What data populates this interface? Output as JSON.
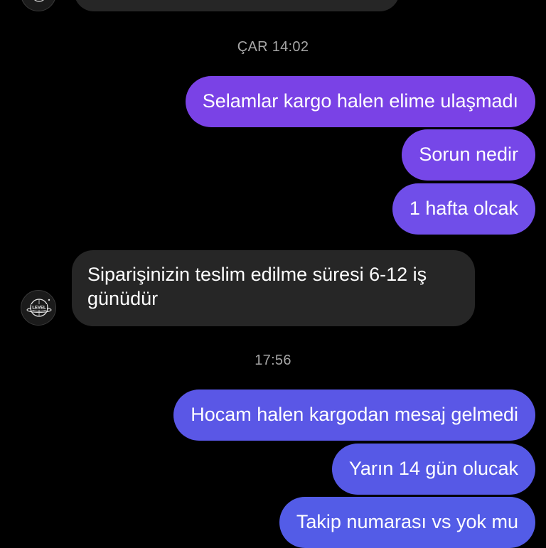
{
  "thread": {
    "timestamps": {
      "first": "ÇAR 14:02",
      "second": "17:56"
    },
    "avatar": {
      "icon": "brand-logo-icon",
      "text": "LEVEL"
    },
    "messages": [
      {
        "direction": "outgoing",
        "text": "Selamlar kargo halen elime ulaşmadı",
        "color": "#7a42e6"
      },
      {
        "direction": "outgoing",
        "text": "Sorun nedir",
        "color": "#7647e8"
      },
      {
        "direction": "outgoing",
        "text": "1 hafta olcak",
        "color": "#704ee9"
      },
      {
        "direction": "incoming",
        "text": "Siparişinizin teslim edilme süresi 6-12 iş günüdür",
        "color": "#262626"
      },
      {
        "direction": "outgoing",
        "text": "Hocam halen kargodan mesaj gelmedi",
        "color": "#5a57e6"
      },
      {
        "direction": "outgoing",
        "text": "Yarın 14 gün olucak",
        "color": "#5659e6"
      },
      {
        "direction": "outgoing",
        "text": "Takip numarası vs yok mu",
        "color": "#535ce7"
      }
    ]
  }
}
